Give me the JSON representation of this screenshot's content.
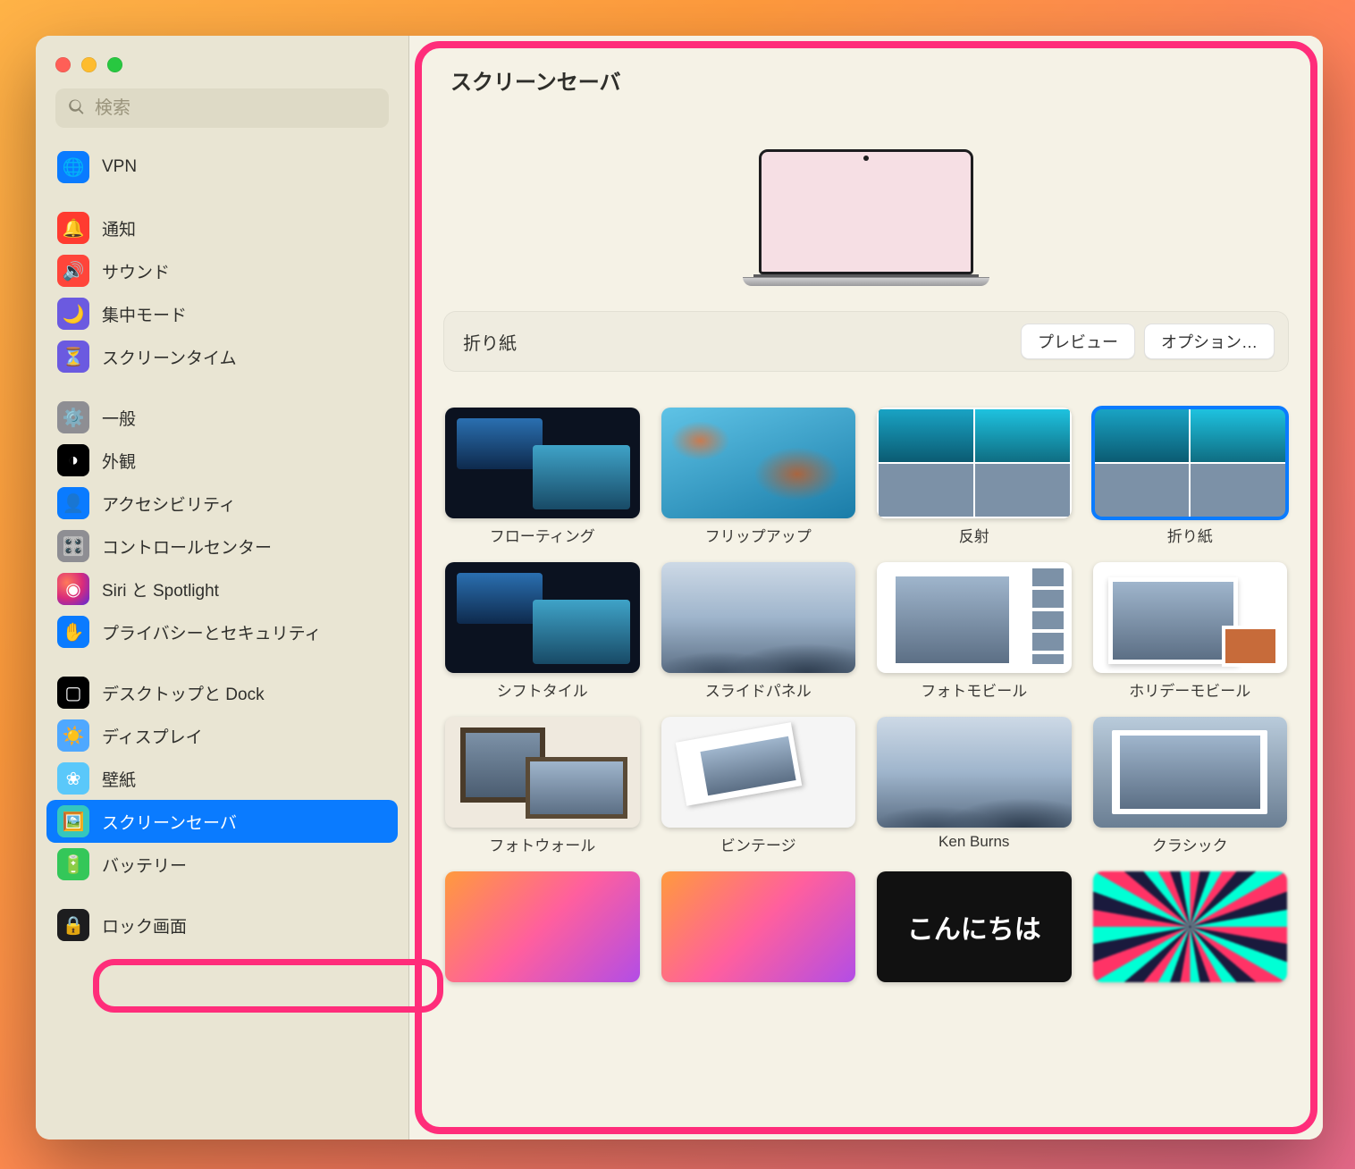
{
  "search": {
    "placeholder": "検索"
  },
  "sidebar": {
    "items": [
      {
        "label": "VPN"
      },
      {
        "label": "通知"
      },
      {
        "label": "サウンド"
      },
      {
        "label": "集中モード"
      },
      {
        "label": "スクリーンタイム"
      },
      {
        "label": "一般"
      },
      {
        "label": "外観"
      },
      {
        "label": "アクセシビリティ"
      },
      {
        "label": "コントロールセンター"
      },
      {
        "label": "Siri と Spotlight"
      },
      {
        "label": "プライバシーとセキュリティ"
      },
      {
        "label": "デスクトップと Dock"
      },
      {
        "label": "ディスプレイ"
      },
      {
        "label": "壁紙"
      },
      {
        "label": "スクリーンセーバ"
      },
      {
        "label": "バッテリー"
      },
      {
        "label": "ロック画面"
      }
    ]
  },
  "main": {
    "title": "スクリーンセーバ",
    "selected_name": "折り紙",
    "preview_btn": "プレビュー",
    "options_btn": "オプション…"
  },
  "savers": [
    {
      "label": "フローティング"
    },
    {
      "label": "フリップアップ"
    },
    {
      "label": "反射"
    },
    {
      "label": "折り紙"
    },
    {
      "label": "シフトタイル"
    },
    {
      "label": "スライドパネル"
    },
    {
      "label": "フォトモビール"
    },
    {
      "label": "ホリデーモビール"
    },
    {
      "label": "フォトウォール"
    },
    {
      "label": "ビンテージ"
    },
    {
      "label": "Ken Burns"
    },
    {
      "label": "クラシック"
    },
    {
      "label": ""
    },
    {
      "label": ""
    },
    {
      "label": "こんにちは"
    },
    {
      "label": ""
    }
  ]
}
